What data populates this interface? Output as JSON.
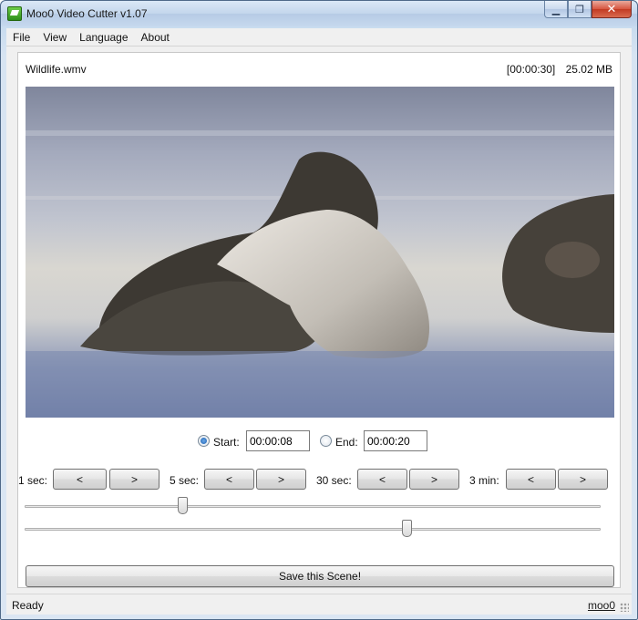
{
  "window": {
    "title": "Moo0 Video Cutter v1.07",
    "minimize_glyph": "▁",
    "maximize_glyph": "❐",
    "close_glyph": "✕"
  },
  "menu": {
    "items": [
      "File",
      "View",
      "Language",
      "About"
    ]
  },
  "file": {
    "name": "Wildlife.wmv",
    "duration": "[00:00:30]",
    "size": "25.02 MB"
  },
  "range": {
    "start_label": "Start:",
    "start_value": "00:00:08",
    "start_selected": true,
    "end_label": "End:",
    "end_value": "00:00:20",
    "end_selected": false
  },
  "steppers": [
    {
      "label": "1 sec:",
      "back": "<",
      "forward": ">"
    },
    {
      "label": "5 sec:",
      "back": "<",
      "forward": ">"
    },
    {
      "label": "30 sec:",
      "back": "<",
      "forward": ">"
    },
    {
      "label": "3 min:",
      "back": "<",
      "forward": ">"
    }
  ],
  "sliders": {
    "start_position_fraction": 0.27,
    "end_position_fraction": 0.667
  },
  "save_button": "Save this Scene!",
  "status": {
    "text": "Ready",
    "link": "moo0"
  },
  "colors": {
    "radio_accent": "#1c5fb0",
    "title_bar": "#c3d6ec",
    "close_button": "#c23a22"
  }
}
